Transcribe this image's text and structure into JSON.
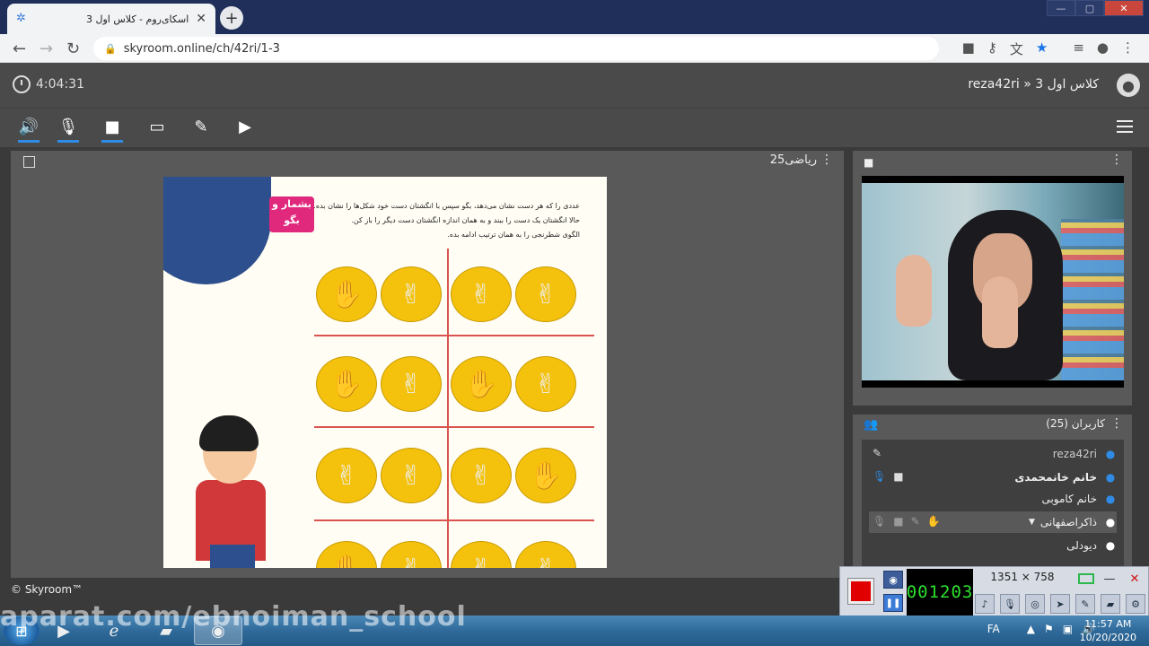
{
  "browser": {
    "tab_title": "اسکای‌روم - کلاس اول 3",
    "url": "skyroom.online/ch/42ri/1-3"
  },
  "app": {
    "timer": "4:04:31",
    "room_title": "reza42ri » کلاس اول 3",
    "board_title": "ریاضی25",
    "copyright": "© Skyroom™"
  },
  "worksheet": {
    "badge": "بشمار و بگو",
    "lines": [
      "عددی را که هر دست نشان می‌دهد، بگو سپس با انگشتان دست خود شکل‌ها را نشان بده.",
      "حالا انگشتان یک دست را ببند و به همان اندازه انگشتان دست دیگر را باز کن.",
      "الگوی شطرنجی را به همان ترتیب ادامه بده."
    ]
  },
  "users": {
    "title": "کاربران (25)",
    "list": [
      {
        "name": "reza42ri",
        "bold": false
      },
      {
        "name": "خانم خانمحمدی",
        "bold": true
      },
      {
        "name": "خانم کاموبی",
        "bold": false
      },
      {
        "name": "ذاکراصفهانی",
        "bold": false
      },
      {
        "name": "دیودلی",
        "bold": false
      }
    ]
  },
  "recorder": {
    "counter": "001203",
    "dimensions": "1351 × 758"
  },
  "taskbar": {
    "watermark": "aparat.com/ebnoiman_school",
    "lang": "FA",
    "time": "11:57 AM",
    "date": "10/20/2020"
  },
  "colors": {
    "accent": "#2f8be6",
    "record": "#e00000",
    "counter": "#2ee02e"
  }
}
